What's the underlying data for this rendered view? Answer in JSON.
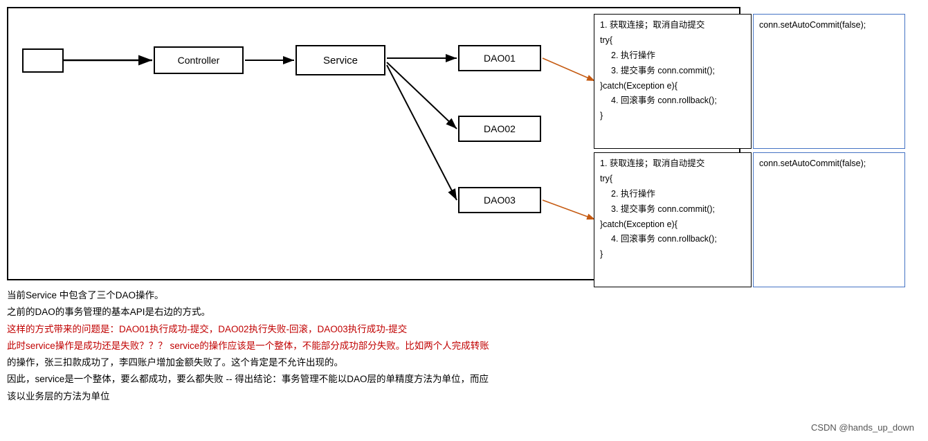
{
  "diagram": {
    "client_label": "",
    "controller_label": "Controller",
    "service_label": "Service",
    "dao01_label": "DAO01",
    "dao02_label": "DAO02",
    "dao03_label": "DAO03"
  },
  "code_top_left": {
    "line1": "1. 获取连接；取消自动提交",
    "line2": "try{",
    "line3": "  2. 执行操作",
    "line4": "  3. 提交事务    conn.commit();",
    "line5": "}catch(Exception e){",
    "line6": "  4. 回滚事务    conn.rollback();",
    "line7": "}"
  },
  "code_top_right": {
    "line1": "conn.setAutoCommit(false);"
  },
  "code_bottom_left": {
    "line1": "1. 获取连接；取消自动提交",
    "line2": "try{",
    "line3": "  2. 执行操作",
    "line4": "  3. 提交事务    conn.commit();",
    "line5": "}catch(Exception e){",
    "line6": "  4. 回滚事务    conn.rollback();",
    "line7": "}"
  },
  "code_bottom_right": {
    "line1": "conn.setAutoCommit(false);"
  },
  "descriptions": [
    {
      "text": "当前Service 中包含了三个DAO操作。",
      "highlight": false
    },
    {
      "text": "之前的DAO的事务管理的基本API是右边的方式。",
      "highlight": false
    },
    {
      "text": "这样的方式带来的问题是：DAO01执行成功-提交，DAO02执行失败-回滚，DAO03执行成功-提交",
      "highlight": true
    },
    {
      "text": "此时service操作是成功还是失败？？？  service的操作应该是一个整体，不能部分成功部分失败。比如两个人完成转账",
      "highlight": true
    },
    {
      "text": "的操作，张三扣款成功了，李四账户增加金额失败了。这个肯定是不允许出现的。",
      "highlight": false
    },
    {
      "text": "因此，service是一个整体，要么都成功，要么都失败 -- 得出结论：事务管理不能以DAO层的单精度方法为单位，而应",
      "highlight": false
    },
    {
      "text": "该以业务层的方法为单位",
      "highlight": false
    }
  ],
  "watermark": "CSDN @hands_up_down"
}
